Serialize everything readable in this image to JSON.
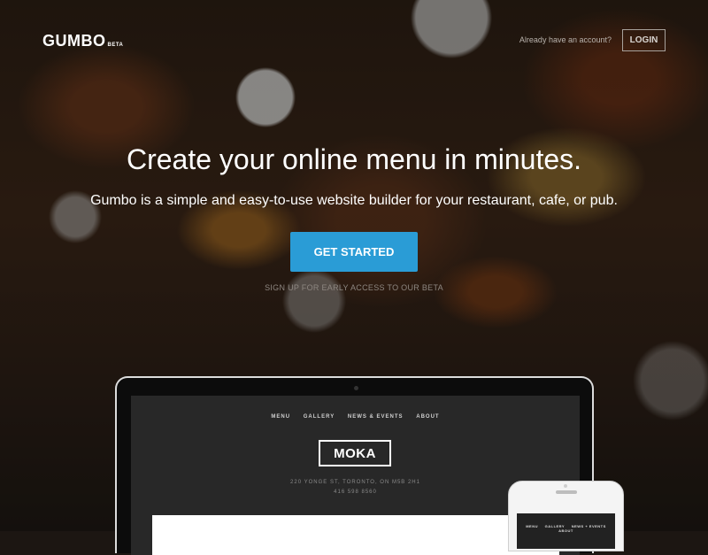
{
  "header": {
    "logo": "GUMBO",
    "logo_badge": "BETA",
    "account_prompt": "Already have an account?",
    "login_label": "LOGIN"
  },
  "hero": {
    "headline": "Create your online menu in minutes.",
    "subheadline": "Gumbo is a simple and easy-to-use website builder for your restaurant, cafe, or pub.",
    "cta_label": "GET STARTED",
    "beta_note": "SIGN UP FOR EARLY ACCESS TO OUR BETA"
  },
  "mockup": {
    "nav": [
      "MENU",
      "GALLERY",
      "NEWS & EVENTS",
      "ABOUT"
    ],
    "brand": "MOKA",
    "address": "220 YONGE ST, TORONTO, ON M5B 2H1",
    "phone": "416 598 8560",
    "mobile_nav": [
      "MENU",
      "GALLERY",
      "NEWS + EVENTS",
      "ABOUT"
    ]
  },
  "colors": {
    "accent": "#2a9cd6",
    "text": "#ffffff"
  }
}
